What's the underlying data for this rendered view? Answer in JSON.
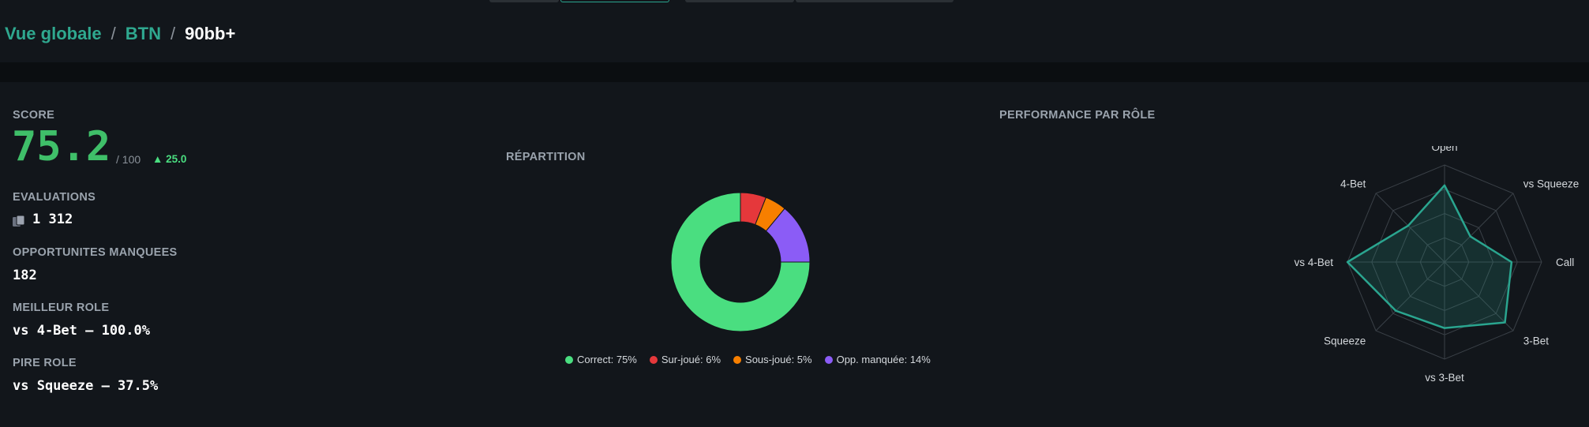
{
  "breadcrumb": {
    "items": [
      "Vue globale",
      "BTN"
    ],
    "separator": "/",
    "current": "90bb+"
  },
  "score": {
    "label": "SCORE",
    "value": "75.2",
    "max": "/ 100",
    "delta": "▲ 25.0"
  },
  "evaluations": {
    "label": "EVALUATIONS",
    "value": "1 312",
    "icon": "cards-icon"
  },
  "missed": {
    "label": "OPPORTUNITES MANQUEES",
    "value": "182"
  },
  "best_role": {
    "label": "MEILLEUR ROLE",
    "value": "vs 4-Bet — 100.0%"
  },
  "worst_role": {
    "label": "PIRE ROLE",
    "value": "vs Squeeze — 37.5%"
  },
  "repartition": {
    "title": "RÉPARTITION",
    "legend": [
      {
        "label": "Correct: 75%",
        "color": "#4ade80"
      },
      {
        "label": "Sur-joué: 6%",
        "color": "#e5383b"
      },
      {
        "label": "Sous-joué: 5%",
        "color": "#f77f00"
      },
      {
        "label": "Opp. manquée: 14%",
        "color": "#8b5cf6"
      }
    ]
  },
  "performance": {
    "title": "PERFORMANCE PAR RÔLE"
  },
  "colors": {
    "accent": "#2aa58f",
    "score": "#3fbf69",
    "background": "#12161b"
  },
  "chart_data": [
    {
      "type": "pie",
      "style": "donut",
      "title": "RÉPARTITION",
      "slices": [
        {
          "name": "Correct",
          "value": 75,
          "color": "#4ade80"
        },
        {
          "name": "Sur-joué",
          "value": 6,
          "color": "#e5383b"
        },
        {
          "name": "Sous-joué",
          "value": 5,
          "color": "#f77f00"
        },
        {
          "name": "Opp. manquée",
          "value": 14,
          "color": "#8b5cf6"
        }
      ],
      "legend": "bottom"
    },
    {
      "type": "radar",
      "title": "PERFORMANCE PAR RÔLE",
      "categories": [
        "Open",
        "vs Squeeze",
        "Call",
        "3-Bet",
        "vs 3-Bet",
        "Squeeze",
        "vs 4-Bet",
        "4-Bet"
      ],
      "values": [
        79,
        37.5,
        69,
        88,
        68,
        71,
        100,
        53
      ],
      "range": [
        0,
        100
      ],
      "rings": 4,
      "color": "#2aa58f"
    }
  ]
}
